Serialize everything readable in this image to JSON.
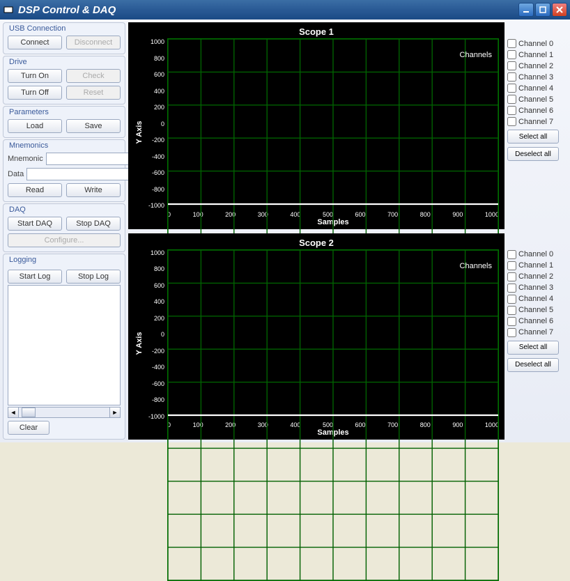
{
  "window": {
    "title": "DSP Control & DAQ"
  },
  "usb": {
    "legend": "USB Connection",
    "connect": "Connect",
    "disconnect": "Disconnect"
  },
  "drive": {
    "legend": "Drive",
    "turn_on": "Turn On",
    "check": "Check",
    "turn_off": "Turn Off",
    "reset": "Reset"
  },
  "params": {
    "legend": "Parameters",
    "load": "Load",
    "save": "Save"
  },
  "mnem": {
    "legend": "Mnemonics",
    "mnemonic_label": "Mnemonic",
    "data_label": "Data",
    "mnemonic_value": "",
    "data_value": "",
    "read": "Read",
    "write": "Write"
  },
  "daq": {
    "legend": "DAQ",
    "start": "Start DAQ",
    "stop": "Stop DAQ",
    "configure": "Configure..."
  },
  "logging": {
    "legend": "Logging",
    "start": "Start Log",
    "stop": "Stop Log",
    "clear": "Clear"
  },
  "scopes": [
    {
      "title": "Scope 1",
      "ylabel": "Y Axis",
      "xlabel": "Samples",
      "channels_label": "Channels"
    },
    {
      "title": "Scope 2",
      "ylabel": "Y Axis",
      "xlabel": "Samples",
      "channels_label": "Channels"
    }
  ],
  "channel_labels": [
    "Channel 0",
    "Channel 1",
    "Channel 2",
    "Channel 3",
    "Channel 4",
    "Channel 5",
    "Channel 6",
    "Channel 7"
  ],
  "select_all": "Select all",
  "deselect_all": "Deselect all",
  "chart_data": [
    {
      "type": "line",
      "title": "Scope 1",
      "xlabel": "Samples",
      "ylabel": "Y Axis",
      "xlim": [
        0,
        1000
      ],
      "ylim": [
        -1000,
        1000
      ],
      "xticks": [
        0,
        100,
        200,
        300,
        400,
        500,
        600,
        700,
        800,
        900,
        1000
      ],
      "yticks": [
        1000,
        800,
        600,
        400,
        200,
        0,
        -200,
        -400,
        -600,
        -800,
        -1000
      ],
      "series": []
    },
    {
      "type": "line",
      "title": "Scope 2",
      "xlabel": "Samples",
      "ylabel": "Y Axis",
      "xlim": [
        0,
        1000
      ],
      "ylim": [
        -1000,
        1000
      ],
      "xticks": [
        0,
        100,
        200,
        300,
        400,
        500,
        600,
        700,
        800,
        900,
        1000
      ],
      "yticks": [
        1000,
        800,
        600,
        400,
        200,
        0,
        -200,
        -400,
        -600,
        -800,
        -1000
      ],
      "series": []
    }
  ]
}
